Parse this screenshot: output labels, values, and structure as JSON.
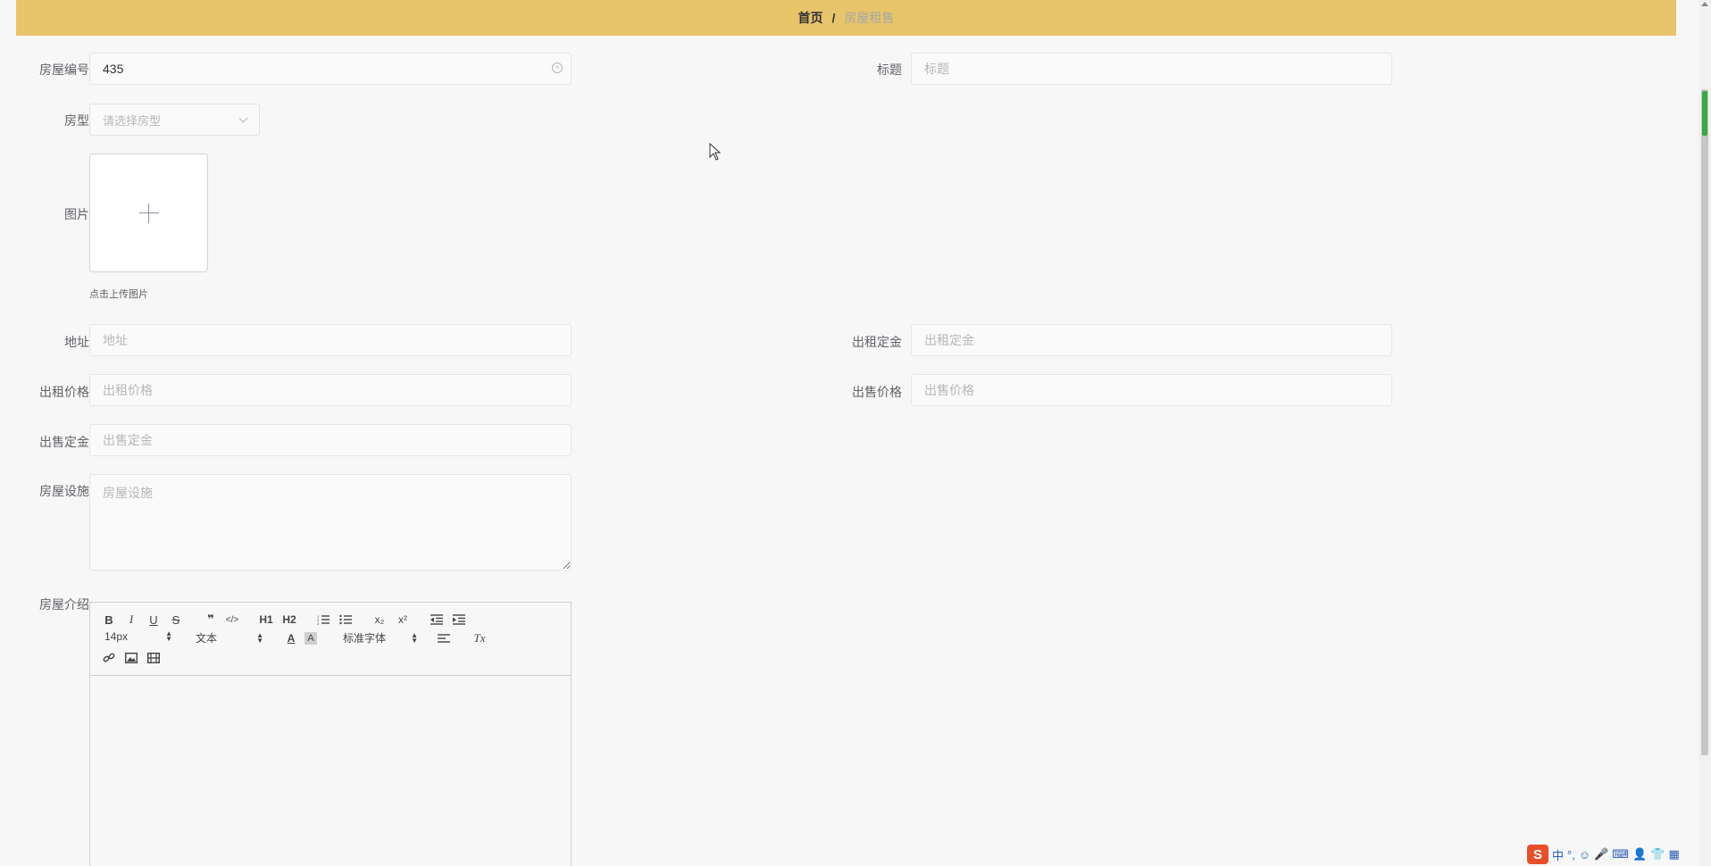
{
  "breadcrumb": {
    "home": "首页",
    "separator": "/",
    "current": "房屋租售"
  },
  "form": {
    "house_no": {
      "label": "房屋编号",
      "value": "435",
      "placeholder": "房屋编号"
    },
    "title": {
      "label": "标题",
      "value": "",
      "placeholder": "标题"
    },
    "house_type": {
      "label": "房型",
      "placeholder": "请选择房型"
    },
    "image": {
      "label": "图片",
      "hint": "点击上传图片"
    },
    "address": {
      "label": "地址",
      "placeholder": "地址"
    },
    "rent_deposit": {
      "label": "出租定金",
      "placeholder": "出租定金"
    },
    "rent_price": {
      "label": "出租价格",
      "placeholder": "出租价格"
    },
    "sale_price": {
      "label": "出售价格",
      "placeholder": "出售价格"
    },
    "sale_deposit": {
      "label": "出售定金",
      "placeholder": "出售定金"
    },
    "facilities": {
      "label": "房屋设施",
      "placeholder": "房屋设施"
    },
    "intro": {
      "label": "房屋介绍"
    }
  },
  "editor": {
    "font_size": "14px",
    "header": "文本",
    "font_family": "标准字体",
    "buttons": {
      "bold": "B",
      "italic": "I",
      "underline": "U",
      "strike": "S",
      "blockquote": "❞",
      "code": "</>",
      "h1": "H1",
      "h2": "H2",
      "subscript": "x₂",
      "superscript": "x²",
      "clean": "Tx",
      "color": "A",
      "background": "A"
    }
  },
  "ime": {
    "logo": "S",
    "mode": "中",
    "punct": "°,",
    "emoji": "☺",
    "mic": "🎤",
    "keyboard": "⌨",
    "user": "👤",
    "skin": "👕",
    "menu": "▦"
  }
}
